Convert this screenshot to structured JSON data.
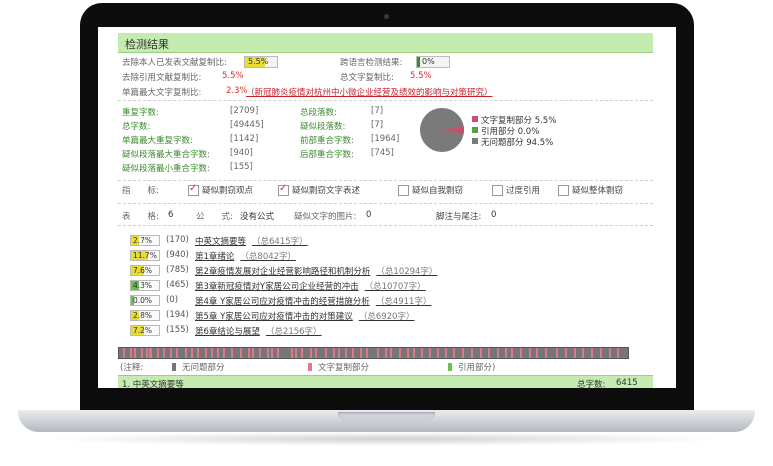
{
  "report": {
    "title": "检测结果",
    "self_excl_label": "去除本人已发表文献复制比:",
    "self_excl_value": "5.5%",
    "cross_lang_label": "跨语言检测结果:",
    "cross_lang_value": "0%",
    "cite_excl_label": "去除引用文献复制比:",
    "cite_excl_value": "5.5%",
    "total_copy_label": "总文字复制比:",
    "total_copy_value": "5.5%",
    "single_max_label": "单篇最大文字复制比:",
    "single_max_value": "2.3%",
    "single_max_title": "（新冠肺炎疫情对杭州中小微企业经营及绩效的影响与对策研究）"
  },
  "stats": {
    "rows": [
      {
        "l_label": "重复字数:",
        "l_value": "[2709]",
        "r_label": "总段落数:",
        "r_value": "[7]"
      },
      {
        "l_label": "总字数:",
        "l_value": "[49445]",
        "r_label": "疑似段落数:",
        "r_value": "[7]"
      },
      {
        "l_label": "单篇最大重复字数:",
        "l_value": "[1142]",
        "r_label": "前部重合字数:",
        "r_value": "[1964]"
      },
      {
        "l_label": "疑似段落最大重合字数:",
        "l_value": "[940]",
        "r_label": "后部重合字数:",
        "r_value": "[745]"
      },
      {
        "l_label": "疑似段落最小重合字数:",
        "l_value": "[155]",
        "r_label": "",
        "r_value": ""
      }
    ]
  },
  "pie": {
    "legend": [
      {
        "label": "文字复制部分 5.5%",
        "color": "#c9506a",
        "pct": 5.5
      },
      {
        "label": "引用部分 0.0%",
        "color": "#5a9e4a",
        "pct": 0.0
      },
      {
        "label": "无问题部分 94.5%",
        "color": "#7a7a7a",
        "pct": 94.5
      }
    ]
  },
  "indicators": {
    "label": "指　　标:",
    "items": [
      {
        "label": "疑似剽窃观点",
        "checked": true
      },
      {
        "label": "疑似剽窃文字表述",
        "checked": true
      },
      {
        "label": "疑似自我剽窃",
        "checked": false
      },
      {
        "label": "过度引用",
        "checked": false
      },
      {
        "label": "疑似整体剽窃",
        "checked": false
      }
    ]
  },
  "misc": {
    "table_label": "表　　格:",
    "table_value": "6",
    "formula_label": "公　　式:",
    "formula_value": "没有公式",
    "image_label": "疑似文字的图片:",
    "image_value": "0",
    "footnote_label": "脚注与尾注:",
    "footnote_value": "0"
  },
  "chapters": [
    {
      "pct": "2.7%",
      "fill": 0.27,
      "count": "(170)",
      "name": "中英文摘要等",
      "total": "（总6415字）",
      "color": "#e6dc33"
    },
    {
      "pct": "11.7%",
      "fill": 0.6,
      "count": "(940)",
      "name": "第1章绪论",
      "total": "（总8042字）",
      "color": "#e6dc33"
    },
    {
      "pct": "7.6%",
      "fill": 0.45,
      "count": "(785)",
      "name": "第2章疫情发展对企业经营影响路径和机制分析",
      "total": "（总10294字）",
      "color": "#e6dc33"
    },
    {
      "pct": "4.3%",
      "fill": 0.3,
      "count": "(465)",
      "name": "第3章新冠疫情对Y家居公司企业经营的冲击",
      "total": "（总10707字）",
      "color": "#6bbf4e"
    },
    {
      "pct": "0.0%",
      "fill": 0.12,
      "count": "(0)",
      "name": "第4章 Y家居公司应对疫情冲击的经营措施分析",
      "total": "（总4911字）",
      "color": "#6bbf4e"
    },
    {
      "pct": "2.8%",
      "fill": 0.27,
      "count": "(194)",
      "name": "第5章 Y家居公司应对疫情冲击的对策建议",
      "total": "（总6920字）",
      "color": "#e6dc33"
    },
    {
      "pct": "7.2%",
      "fill": 0.45,
      "count": "(155)",
      "name": "第6章结论与展望",
      "total": "（总2156字）",
      "color": "#e6dc33"
    }
  ],
  "strip_marks": [
    4,
    11,
    15,
    22,
    27,
    30,
    31,
    38,
    44,
    51,
    57,
    66,
    72,
    78,
    86,
    92,
    98,
    104,
    112,
    121,
    129,
    133,
    140,
    148,
    152,
    158,
    172,
    176,
    182,
    191,
    196,
    206,
    214,
    219,
    226,
    233,
    241,
    247,
    258,
    266,
    271,
    280,
    288,
    294,
    302,
    310,
    318,
    326,
    334,
    343,
    352,
    361,
    369,
    378,
    386,
    392,
    401,
    410,
    417,
    426,
    437,
    446,
    455,
    463,
    472,
    481,
    490,
    498
  ],
  "legend": {
    "prefix": "(注释:",
    "none_label": "无问题部分",
    "copy_label": "文字复制部分",
    "cite_label": "引用部分)"
  },
  "footer": {
    "section": "1. 中英文摘要等",
    "total_label": "总字数:",
    "total_value": "6415"
  }
}
